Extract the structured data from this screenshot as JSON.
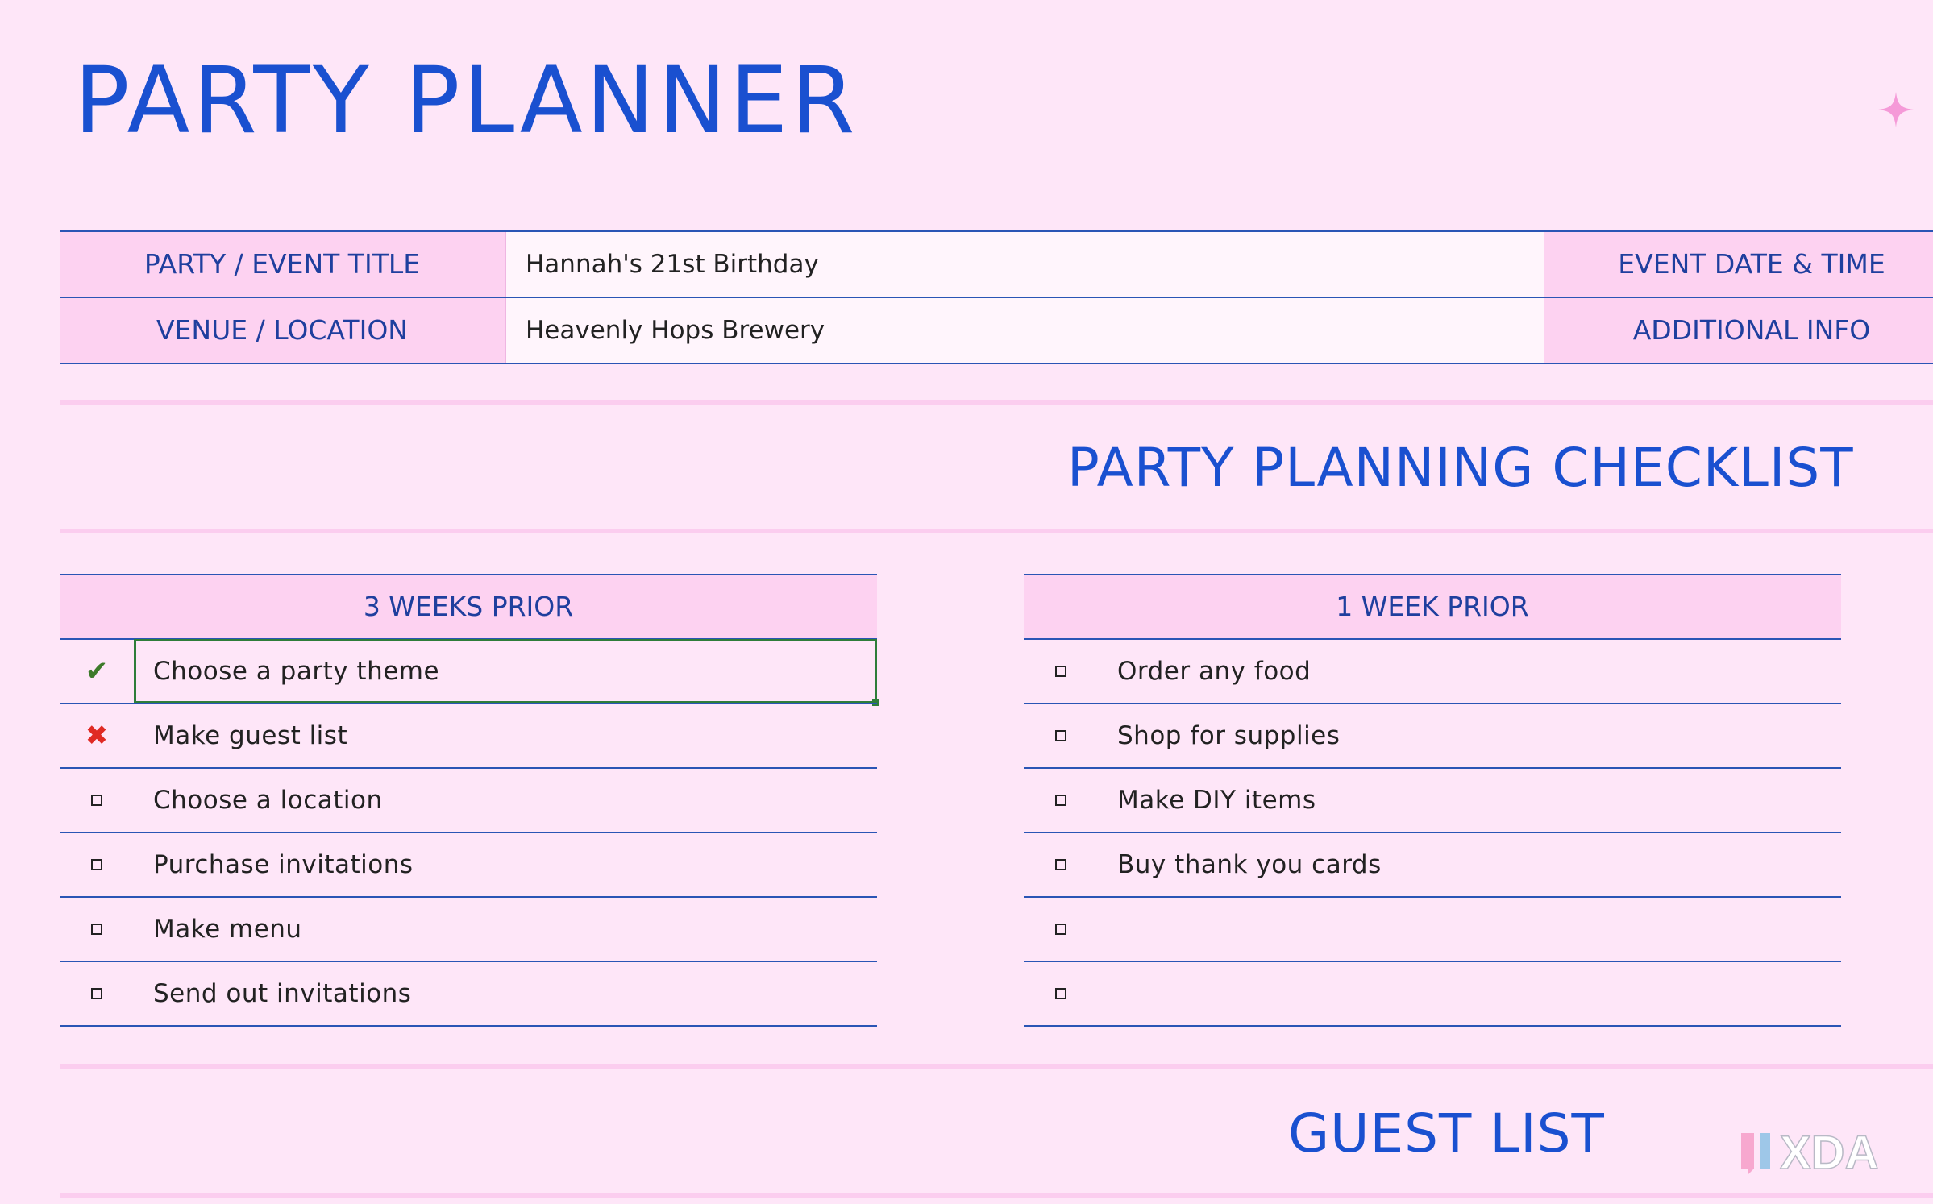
{
  "title": "PARTY PLANNER",
  "info": {
    "event_title_label": "PARTY / EVENT TITLE",
    "event_title_value": "Hannah's 21st Birthday",
    "event_date_label": "EVENT DATE & TIME",
    "venue_label": "VENUE / LOCATION",
    "venue_value": "Heavenly Hops Brewery",
    "additional_label": "ADDITIONAL INFO"
  },
  "checklist": {
    "title": "PARTY PLANNING CHECKLIST",
    "three_weeks": {
      "header": "3 WEEKS PRIOR",
      "items": [
        {
          "status": "checked",
          "text": "Choose a party theme"
        },
        {
          "status": "crossed",
          "text": "Make guest list"
        },
        {
          "status": "empty",
          "text": "Choose a location"
        },
        {
          "status": "empty",
          "text": "Purchase invitations"
        },
        {
          "status": "empty",
          "text": "Make menu"
        },
        {
          "status": "empty",
          "text": "Send out invitations"
        }
      ]
    },
    "one_week": {
      "header": "1 WEEK PRIOR",
      "items": [
        {
          "status": "empty",
          "text": "Order any food"
        },
        {
          "status": "empty",
          "text": "Shop for supplies"
        },
        {
          "status": "empty",
          "text": "Make DIY items"
        },
        {
          "status": "empty",
          "text": "Buy thank you cards"
        },
        {
          "status": "empty",
          "text": ""
        },
        {
          "status": "empty",
          "text": ""
        }
      ]
    }
  },
  "guest_list": {
    "title": "GUEST LIST"
  },
  "icons": {
    "check": "✔",
    "cross": "✖",
    "checkbox": "checkbox-empty-icon"
  },
  "colors": {
    "background": "#fee6f8",
    "accent": "#1a50d0",
    "header_fill": "#fdd2f1",
    "rule": "#2a55b5",
    "selection": "#2e7d3a"
  },
  "watermark": "XDA"
}
